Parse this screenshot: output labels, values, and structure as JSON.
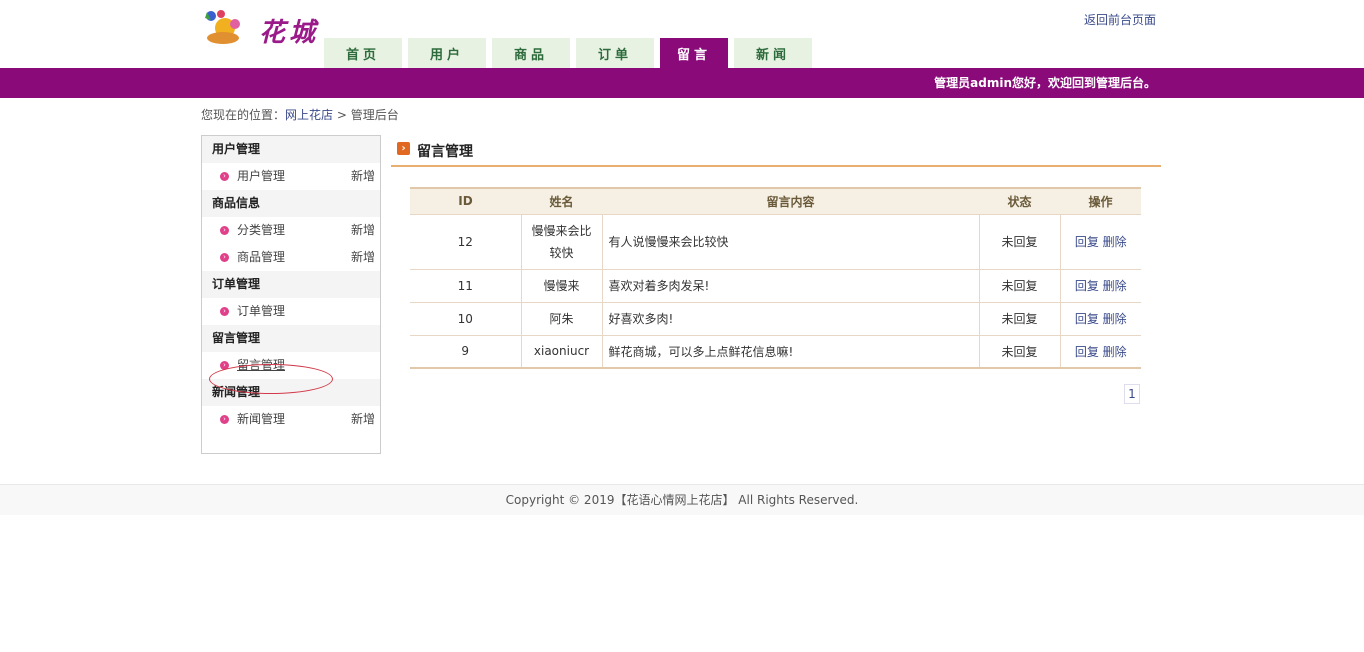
{
  "header": {
    "logo_text": "花城",
    "top_link": "返回前台页面",
    "nav": [
      "首页",
      "用户",
      "商品",
      "订单",
      "留言",
      "新闻"
    ],
    "active_tab": "留言",
    "welcome": "管理员admin您好，欢迎回到管理后台。",
    "accent_color": "#8a0a7a"
  },
  "breadcrumb": {
    "prefix": "您现在的位置：",
    "home": "网上花店",
    "sep": ">",
    "current": "管理后台"
  },
  "sidebar": {
    "sections": [
      {
        "title": "用户管理",
        "items": [
          {
            "label": "用户管理",
            "add": "新增"
          }
        ]
      },
      {
        "title": "商品信息",
        "items": [
          {
            "label": "分类管理",
            "add": "新增"
          },
          {
            "label": "商品管理",
            "add": "新增"
          }
        ]
      },
      {
        "title": "订单管理",
        "items": [
          {
            "label": "订单管理",
            "add": ""
          }
        ]
      },
      {
        "title": "留言管理",
        "items": [
          {
            "label": "留言管理",
            "add": ""
          }
        ]
      },
      {
        "title": "新闻管理",
        "items": [
          {
            "label": "新闻管理",
            "add": "新增"
          }
        ]
      }
    ]
  },
  "main": {
    "title": "留言管理",
    "table": {
      "headers": [
        "ID",
        "姓名",
        "留言内容",
        "状态",
        "操作"
      ],
      "rows": [
        {
          "id": "12",
          "name": "慢慢来会比较快",
          "content": "有人说慢慢来会比较快",
          "status": "未回复",
          "reply": "回复",
          "delete": "删除"
        },
        {
          "id": "11",
          "name": "慢慢来",
          "content": "喜欢对着多肉发呆!",
          "status": "未回复",
          "reply": "回复",
          "delete": "删除"
        },
        {
          "id": "10",
          "name": "阿朱",
          "content": "好喜欢多肉!",
          "status": "未回复",
          "reply": "回复",
          "delete": "删除"
        },
        {
          "id": "9",
          "name": "xiaoniucr",
          "content": "鲜花商城，可以多上点鲜花信息嘛!",
          "status": "未回复",
          "reply": "回复",
          "delete": "删除"
        }
      ]
    },
    "pager": "1"
  },
  "footer": {
    "text": "Copyright © 2019【花语心情网上花店】 All Rights Reserved."
  }
}
